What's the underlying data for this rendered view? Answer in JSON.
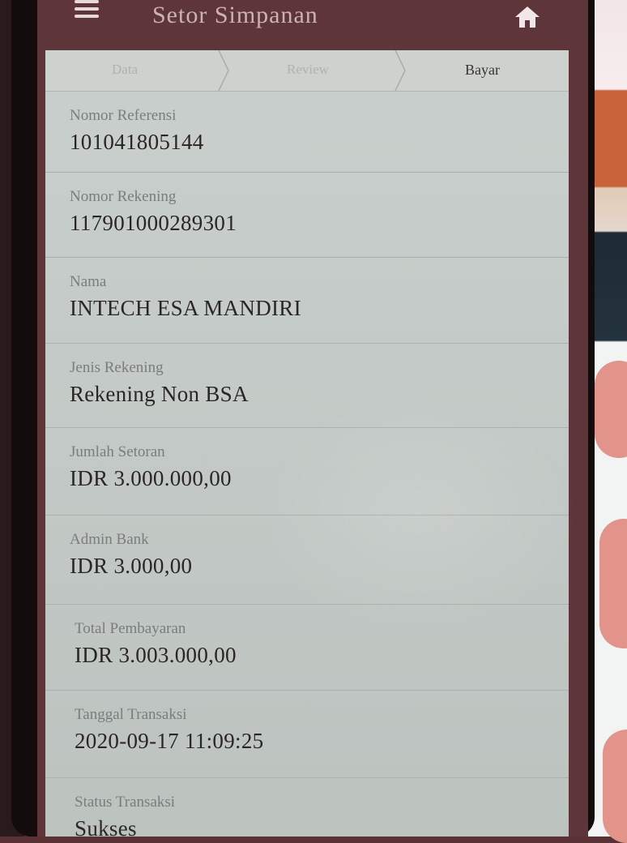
{
  "header": {
    "title": "Setor Simpanan",
    "menu_icon": "hamburger-menu-icon",
    "home_icon": "home-icon"
  },
  "steps": [
    {
      "label": "Data",
      "active": false
    },
    {
      "label": "Review",
      "active": false
    },
    {
      "label": "Bayar",
      "active": true
    }
  ],
  "fields": [
    {
      "label": "Nomor Referensi",
      "value": "101041805144"
    },
    {
      "label": "Nomor Rekening",
      "value": "117901000289301"
    },
    {
      "label": "Nama",
      "value": "INTECH ESA MANDIRI"
    },
    {
      "label": "Jenis Rekening",
      "value": "Rekening Non BSA"
    },
    {
      "label": "Jumlah Setoran",
      "value": "IDR 3.000.000,00"
    },
    {
      "label": "Admin Bank",
      "value": "IDR 3.000,00"
    },
    {
      "label": "Total Pembayaran",
      "value": "IDR 3.003.000,00"
    },
    {
      "label": "Tanggal Transaksi",
      "value": "2020-09-17 11:09:25"
    },
    {
      "label": "Status Transaksi",
      "value": "Sukses"
    }
  ],
  "colors": {
    "appbar": "#5e363a",
    "card": "#c9cfcc",
    "text": "#2a2526",
    "label": "#7c7c7c"
  }
}
